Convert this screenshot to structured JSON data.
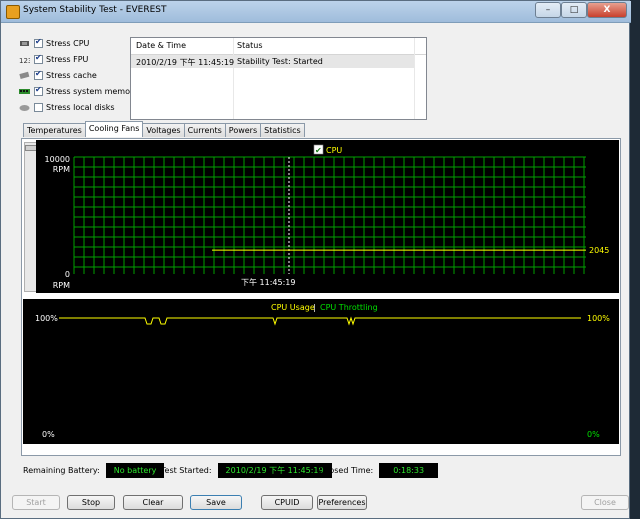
{
  "window": {
    "title": "System Stability Test - EVEREST",
    "minimize": "–",
    "maximize": "□",
    "close": "X"
  },
  "stress_options": [
    {
      "label": "Stress CPU",
      "checked": true,
      "icon": "cpu-icon"
    },
    {
      "label": "Stress FPU",
      "checked": true,
      "icon": "fpu-icon"
    },
    {
      "label": "Stress cache",
      "checked": true,
      "icon": "cache-icon"
    },
    {
      "label": "Stress system memory",
      "checked": true,
      "icon": "memory-icon"
    },
    {
      "label": "Stress local disks",
      "checked": false,
      "icon": "disk-icon"
    }
  ],
  "log": {
    "headers": [
      "Date & Time",
      "Status"
    ],
    "rows": [
      {
        "datetime": "2010/2/19 下午 11:45:19",
        "status": "Stability Test: Started"
      }
    ]
  },
  "tabs": [
    "Temperatures",
    "Cooling Fans",
    "Voltages",
    "Currents",
    "Powers",
    "Statistics"
  ],
  "active_tab": "Cooling Fans",
  "fan_chart": {
    "legend": "CPU",
    "y_max_label": "10000",
    "y_min_label": "0",
    "y_unit": "RPM",
    "current_value_label": "2045",
    "time_marker": "下午 11:45:19"
  },
  "cpu_chart": {
    "legend_usage": "CPU Usage",
    "legend_sep": "|",
    "legend_throttling": "CPU Throttling",
    "left_top": "100%",
    "left_bottom": "0%",
    "right_top": "100%",
    "right_bottom": "0%"
  },
  "chart_data": [
    {
      "type": "line",
      "title": "",
      "series": [
        {
          "name": "CPU",
          "values": [
            2045
          ]
        }
      ],
      "ylim": [
        0,
        10000
      ],
      "ylabel": "RPM",
      "xlabel": "",
      "marker": "下午 11:45:19",
      "grid": true,
      "colors": {
        "line": "#ffff00",
        "grid": "#00a000"
      }
    },
    {
      "type": "line",
      "title": "",
      "series": [
        {
          "name": "CPU Usage",
          "values": [
            100
          ]
        },
        {
          "name": "CPU Throttling",
          "values": [
            0
          ]
        }
      ],
      "ylim": [
        0,
        100
      ],
      "grid": true,
      "colors": {
        "usage": "#ffff00",
        "throttling": "#00e000"
      }
    }
  ],
  "status": {
    "battery_label": "Remaining Battery:",
    "battery_value": "No battery",
    "started_label": "Test Started:",
    "started_value": "2010/2/19 下午 11:45:19",
    "elapsed_label": "Elapsed Time:",
    "elapsed_value": "0:18:33"
  },
  "buttons": {
    "start": "Start",
    "stop": "Stop",
    "clear": "Clear",
    "save": "Save",
    "cpuid": "CPUID",
    "preferences": "Preferences",
    "close": "Close"
  }
}
